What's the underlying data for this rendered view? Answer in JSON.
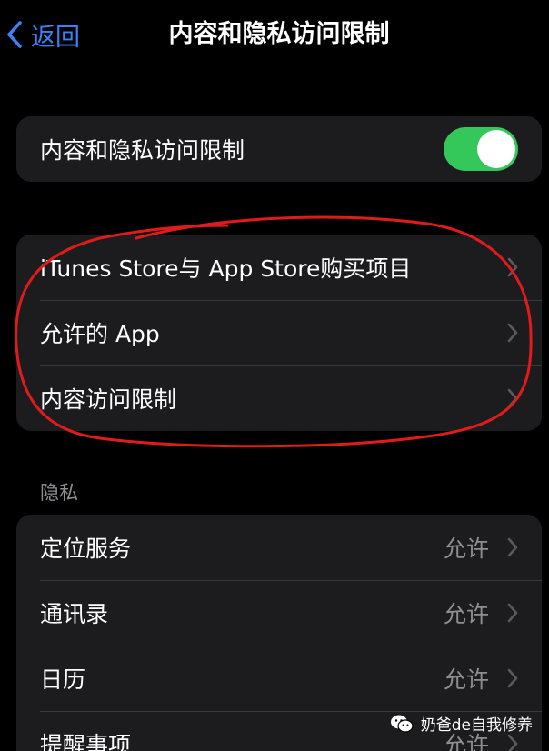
{
  "nav": {
    "back_label": "返回",
    "title": "内容和隐私访问限制"
  },
  "master_toggle": {
    "label": "内容和隐私访问限制",
    "enabled": true,
    "on_color": "#34c759"
  },
  "store_group": {
    "items": [
      {
        "label": "iTunes Store与 App Store购买项目"
      },
      {
        "label": "允许的 App"
      },
      {
        "label": "内容访问限制"
      }
    ]
  },
  "privacy": {
    "header": "隐私",
    "items": [
      {
        "label": "定位服务",
        "value": "允许"
      },
      {
        "label": "通讯录",
        "value": "允许"
      },
      {
        "label": "日历",
        "value": "允许"
      },
      {
        "label": "提醒事项",
        "value": "允许"
      }
    ]
  },
  "watermark": {
    "text": "奶爸de自我修养",
    "icon": "wechat-icon"
  },
  "colors": {
    "accent": "#3b82f6",
    "annotation": "#e01b1b",
    "group_bg": "#1c1c1e"
  }
}
